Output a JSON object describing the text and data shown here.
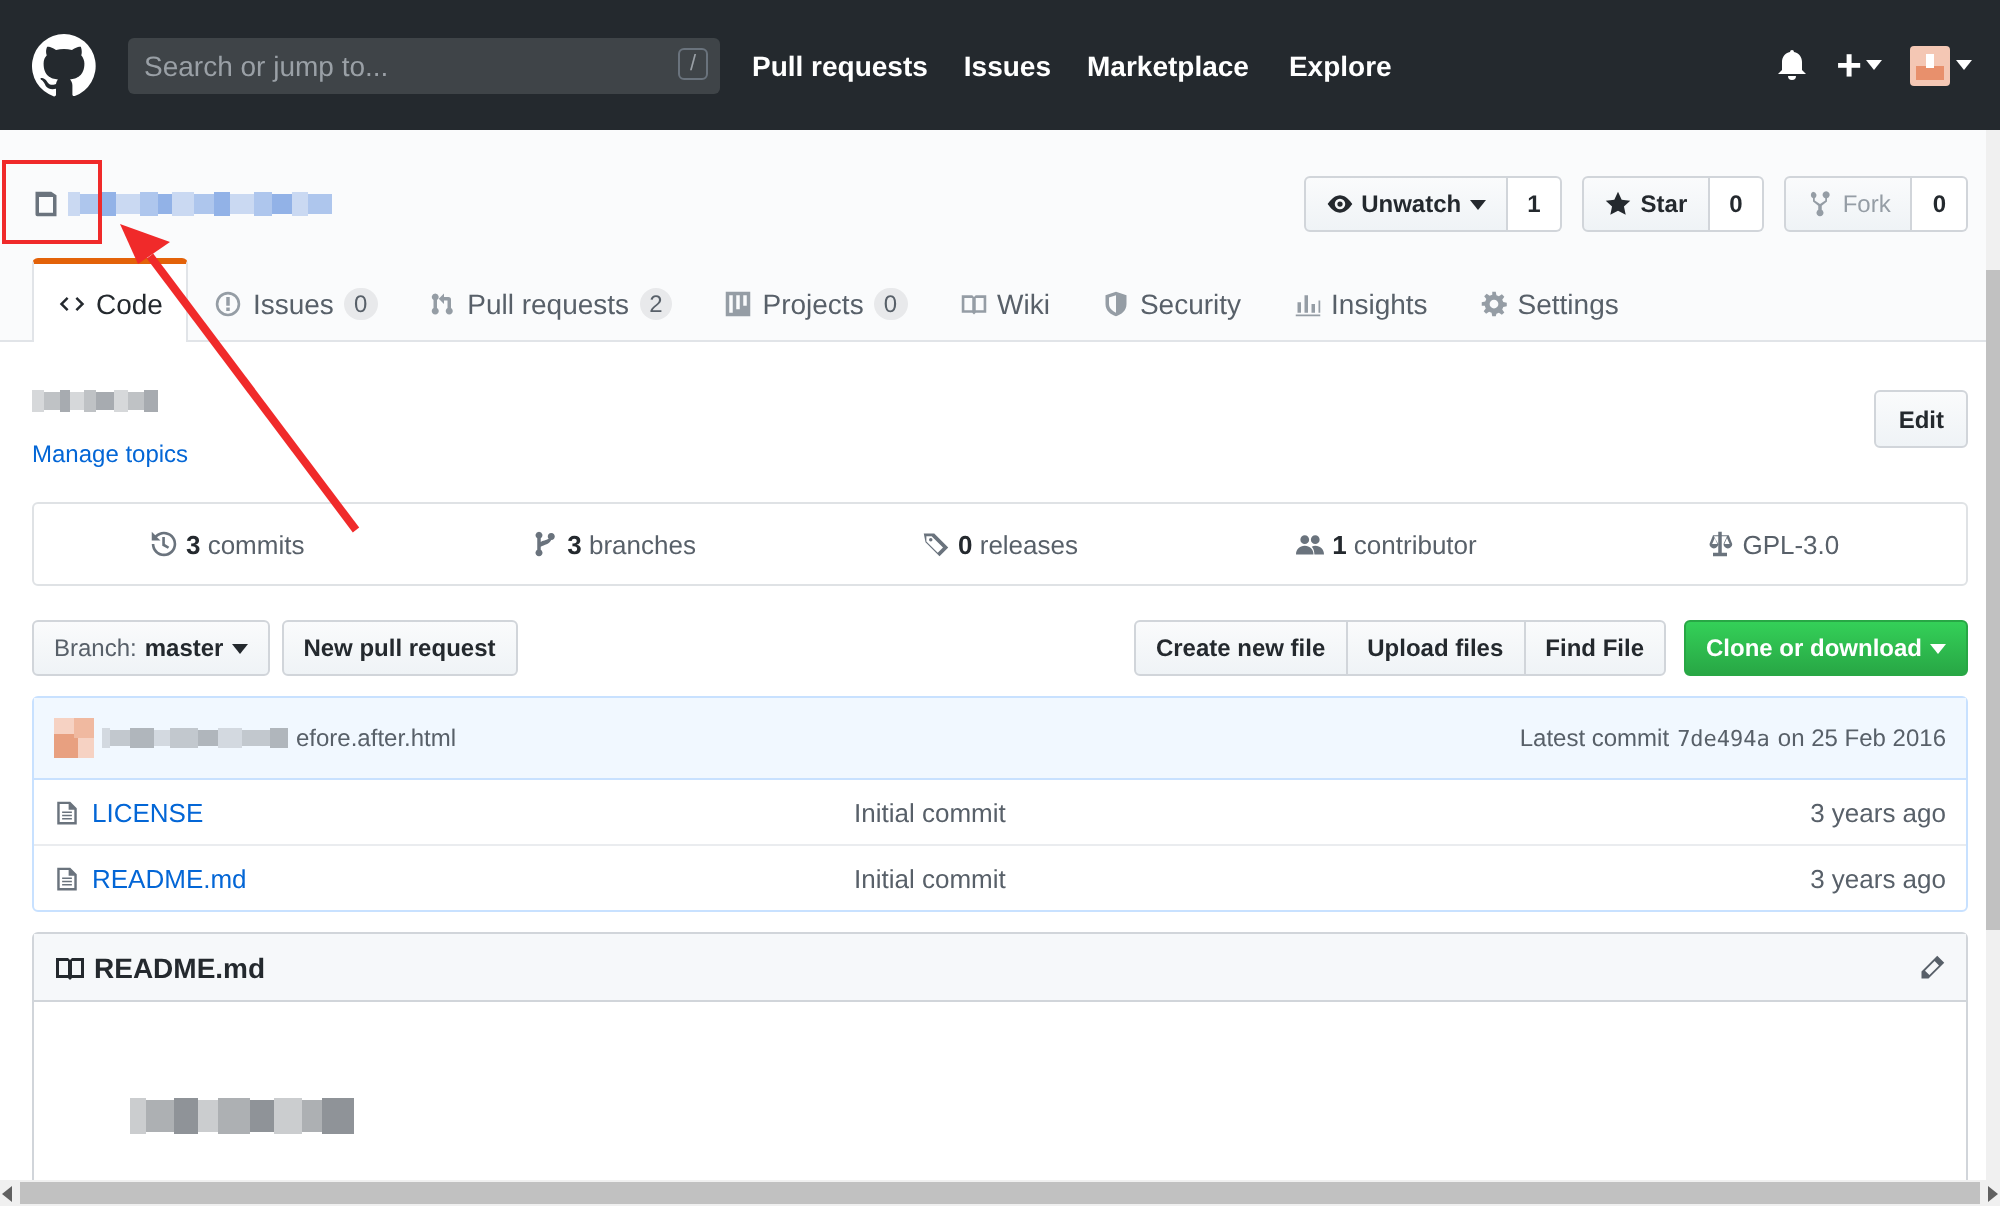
{
  "header": {
    "search_placeholder": "Search or jump to...",
    "search_key": "/",
    "nav": [
      "Pull requests",
      "Issues",
      "Marketplace",
      "Explore"
    ],
    "plus": "+"
  },
  "repo_actions": [
    {
      "kind": "watch",
      "label": "Unwatch",
      "count": "1",
      "disabled": false
    },
    {
      "kind": "star",
      "label": "Star",
      "count": "0",
      "disabled": false
    },
    {
      "kind": "fork",
      "label": "Fork",
      "count": "0",
      "disabled": true
    }
  ],
  "tabs": [
    {
      "kind": "code",
      "label": "Code",
      "selected": true
    },
    {
      "kind": "issues",
      "label": "Issues",
      "counter": "0",
      "selected": false
    },
    {
      "kind": "pulls",
      "label": "Pull requests",
      "counter": "2",
      "selected": false
    },
    {
      "kind": "projects",
      "label": "Projects",
      "counter": "0",
      "selected": false
    },
    {
      "kind": "wiki",
      "label": "Wiki",
      "selected": false
    },
    {
      "kind": "security",
      "label": "Security",
      "selected": false
    },
    {
      "kind": "insights",
      "label": "Insights",
      "selected": false
    },
    {
      "kind": "settings",
      "label": "Settings",
      "selected": false
    }
  ],
  "topics_link": "Manage topics",
  "edit_button": "Edit",
  "summary": [
    {
      "kind": "commits",
      "count": "3",
      "label": "commits"
    },
    {
      "kind": "branches",
      "count": "3",
      "label": "branches"
    },
    {
      "kind": "releases",
      "count": "0",
      "label": "releases"
    },
    {
      "kind": "contributors",
      "count": "1",
      "label": "contributor"
    },
    {
      "kind": "license",
      "label": "GPL-3.0"
    }
  ],
  "branch": {
    "prefix": "Branch:",
    "name": "master"
  },
  "new_pull_request": "New pull request",
  "file_buttons": [
    "Create new file",
    "Upload files",
    "Find File"
  ],
  "clone_button": "Clone or download",
  "commit": {
    "message": "efore.after.html",
    "latest_label": "Latest commit",
    "sha": "7de494a",
    "date": "on 25 Feb 2016"
  },
  "files": [
    {
      "name": "LICENSE",
      "message": "Initial commit",
      "age": "3 years ago"
    },
    {
      "name": "README.md",
      "message": "Initial commit",
      "age": "3 years ago"
    }
  ],
  "readme": {
    "title": "README.md"
  }
}
